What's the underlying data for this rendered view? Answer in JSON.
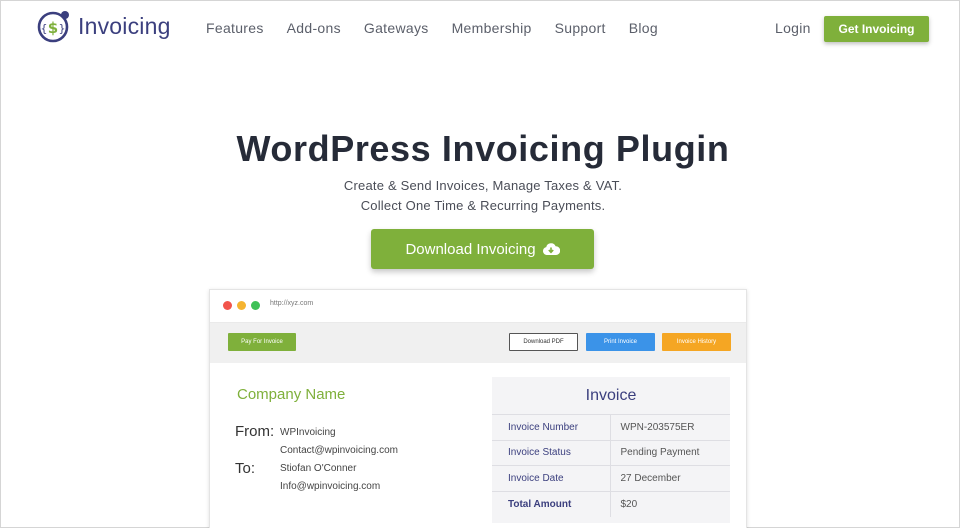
{
  "header": {
    "logo_text": "Invoicing",
    "nav": [
      "Features",
      "Add-ons",
      "Gateways",
      "Membership",
      "Support",
      "Blog"
    ],
    "login": "Login",
    "cta": "Get Invoicing"
  },
  "hero": {
    "title": "WordPress Invoicing Plugin",
    "subtitle_line1": "Create & Send Invoices, Manage Taxes & VAT.",
    "subtitle_line2": "Collect One Time & Recurring Payments.",
    "download_label": "Download Invoicing"
  },
  "browser": {
    "url": "http://xyz.com",
    "buttons": {
      "pay": "Pay For Invoice",
      "pdf": "Download PDF",
      "print": "Print Invoice",
      "history": "Invoice History"
    },
    "company_name": "Company Name",
    "from_label": "From:",
    "to_label": "To:",
    "from_name": "WPInvoicing",
    "from_email": "Contact@wpinvoicing.com",
    "to_name": "Stiofan O'Conner",
    "to_email": "Info@wpinvoicing.com",
    "invoice": {
      "title": "Invoice",
      "rows": [
        {
          "label": "Invoice Number",
          "value": "WPN-203575ER"
        },
        {
          "label": "Invoice Status",
          "value": "Pending Payment"
        },
        {
          "label": "Invoice Date",
          "value": "27 December"
        },
        {
          "label": "Total Amount",
          "value": "$20"
        }
      ]
    }
  },
  "colors": {
    "brand_green": "#7fb03b",
    "brand_navy": "#3b3f7e",
    "print_blue": "#3b93e8",
    "history_orange": "#f5a623"
  }
}
